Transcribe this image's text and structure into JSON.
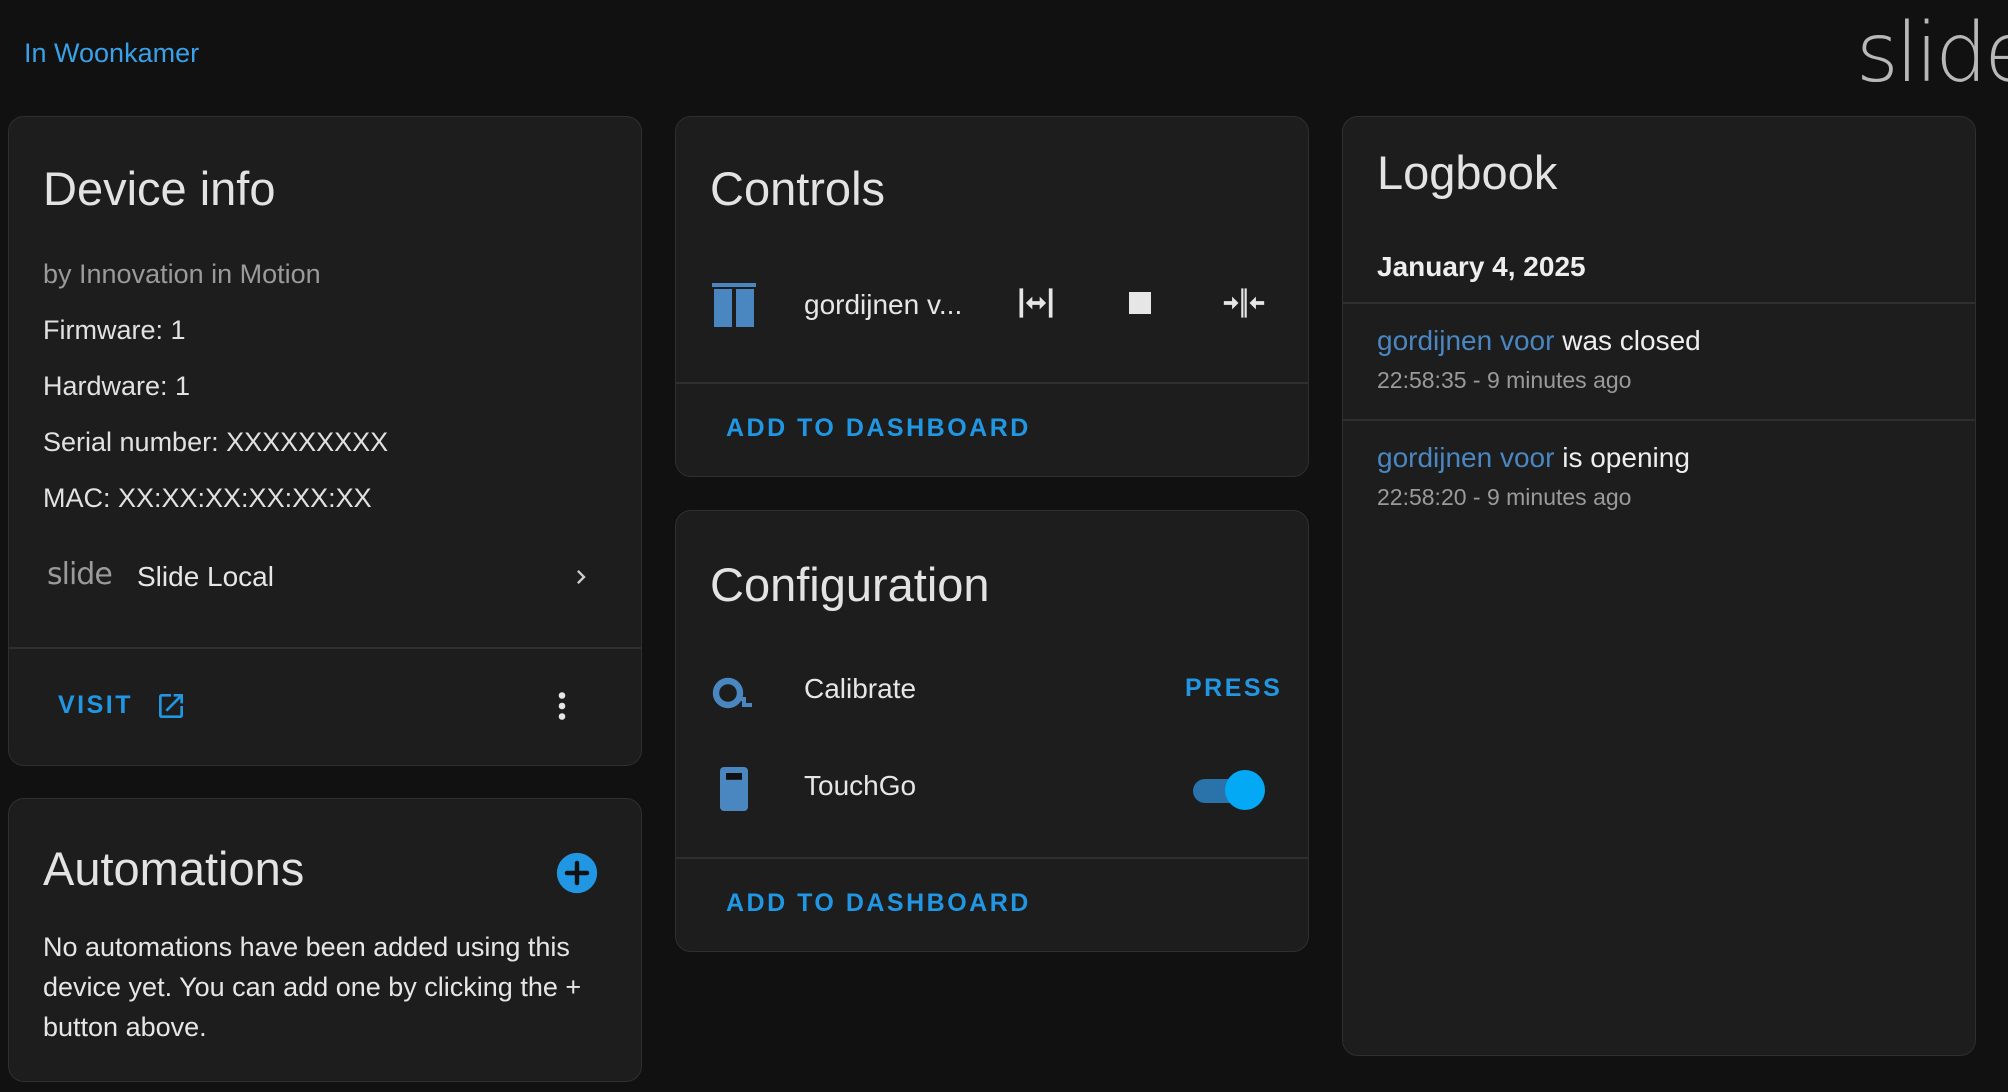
{
  "header": {
    "area_link": "In Woonkamer",
    "brand_logo_text": "slide"
  },
  "device_info": {
    "title": "Device info",
    "manufacturer": "by Innovation in Motion",
    "firmware": "Firmware: 1",
    "hardware": "Hardware: 1",
    "serial": "Serial number: XXXXXXXXX",
    "mac": "MAC: XX:XX:XX:XX:XX:XX",
    "integration_logo_text": "slide",
    "integration_name": "Slide Local",
    "visit_label": "VISIT"
  },
  "automations": {
    "title": "Automations",
    "empty_text": "No automations have been added using this device yet. You can add one by clicking the + button above."
  },
  "controls": {
    "title": "Controls",
    "entity_name": "gordijnen v...",
    "add_label": "ADD TO DASHBOARD"
  },
  "configuration": {
    "title": "Configuration",
    "calibrate_label": "Calibrate",
    "press_label": "PRESS",
    "touchgo_label": "TouchGo",
    "touchgo_on": true,
    "add_label": "ADD TO DASHBOARD"
  },
  "logbook": {
    "title": "Logbook",
    "date": "January 4, 2025",
    "entries": [
      {
        "entity": "gordijnen voor",
        "action": "was closed",
        "time": "22:58:35 - 9 minutes ago"
      },
      {
        "entity": "gordijnen voor",
        "action": "is opening",
        "time": "22:58:20 - 9 minutes ago"
      }
    ]
  },
  "colors": {
    "accent": "#2196e3",
    "entity_icon": "#4a86c0",
    "background": "#111111",
    "card": "#1d1d1d"
  }
}
